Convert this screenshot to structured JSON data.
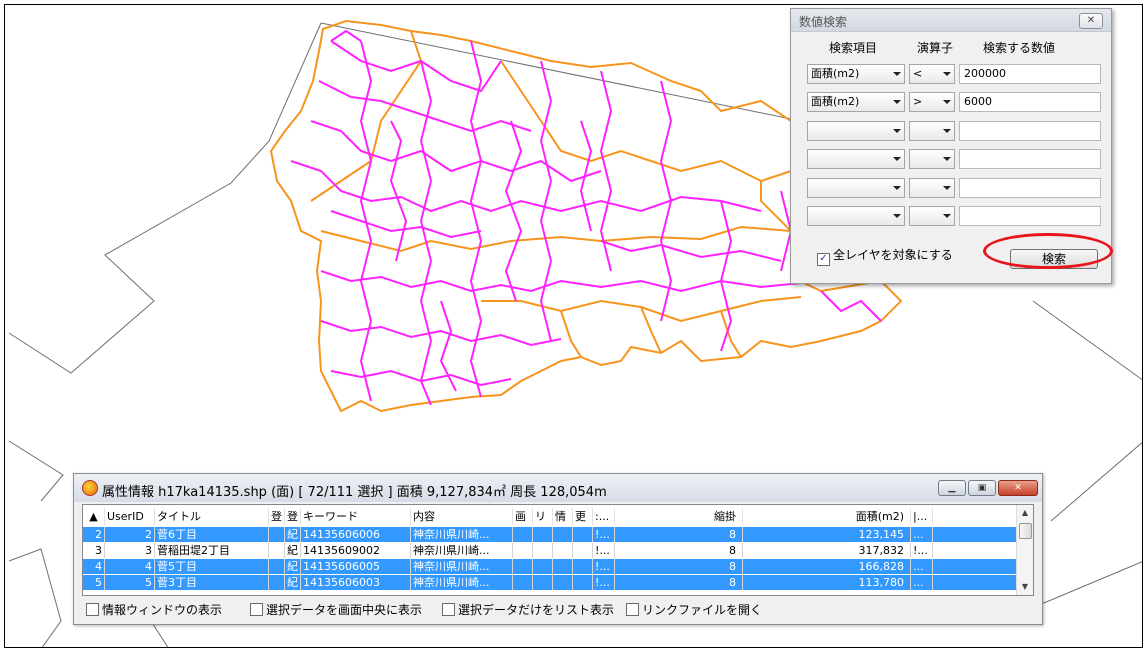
{
  "search_dialog": {
    "title": "数値検索",
    "close_icon": "close-icon",
    "header_field": "検索項目",
    "header_op": "演算子",
    "header_value": "検索する数値",
    "rows": [
      {
        "field": "面積(m2)",
        "op": "<",
        "value": "200000"
      },
      {
        "field": "面積(m2)",
        "op": ">",
        "value": "6000"
      },
      {
        "field": "",
        "op": "",
        "value": ""
      },
      {
        "field": "",
        "op": "",
        "value": ""
      },
      {
        "field": "",
        "op": "",
        "value": ""
      },
      {
        "field": "",
        "op": "",
        "value": ""
      }
    ],
    "all_layers_label": "全レイヤを対象にする",
    "all_layers_checked": true,
    "search_button": "検索",
    "highlight_color": "#e8141a"
  },
  "map": {
    "inner_boundary_color": "#ff22ff",
    "outer_boundary_color": "#f7941d"
  },
  "attr_window": {
    "title": "属性情報  h17ka14135.shp  (面)   [ 72/111 選択 ]   面積 9,127,834㎡   周長 128,054m",
    "columns": [
      "UserID",
      "タイトル",
      "登",
      "登",
      "キーワード",
      "内容",
      "画",
      "リ",
      "情",
      "更",
      ":...",
      "縮掛",
      "面積(m2)",
      "|..."
    ],
    "rows": [
      {
        "num": "2",
        "id": "2",
        "title": "菅6丁目",
        "t1": "",
        "t2": "紀",
        "keyword": "14135606006",
        "content": "神奈川県川崎...",
        "dots": "!...",
        "scale": "8",
        "area": "123,145",
        "last": "...",
        "selected": true
      },
      {
        "num": "3",
        "id": "3",
        "title": "菅稲田堤2丁目",
        "t1": "",
        "t2": "紀",
        "keyword": "14135609002",
        "content": "神奈川県川崎...",
        "dots": "!...",
        "scale": "8",
        "area": "317,832",
        "last": "!...",
        "selected": false
      },
      {
        "num": "4",
        "id": "4",
        "title": "菅5丁目",
        "t1": "",
        "t2": "紀",
        "keyword": "14135606005",
        "content": "神奈川県川崎...",
        "dots": "!...",
        "scale": "8",
        "area": "166,828",
        "last": "...",
        "selected": true
      },
      {
        "num": "5",
        "id": "5",
        "title": "菅3丁目",
        "t1": "",
        "t2": "紀",
        "keyword": "14135606003",
        "content": "神奈川県川崎...",
        "dots": "!...",
        "scale": "8",
        "area": "113,780",
        "last": "...",
        "selected": true
      }
    ],
    "options": [
      {
        "label": "情報ウィンドウの表示",
        "checked": false
      },
      {
        "label": "選択データを画面中央に表示",
        "checked": false
      },
      {
        "label": "選択データだけをリスト表示",
        "checked": false
      },
      {
        "label": "リンクファイルを開く",
        "checked": false
      }
    ]
  }
}
